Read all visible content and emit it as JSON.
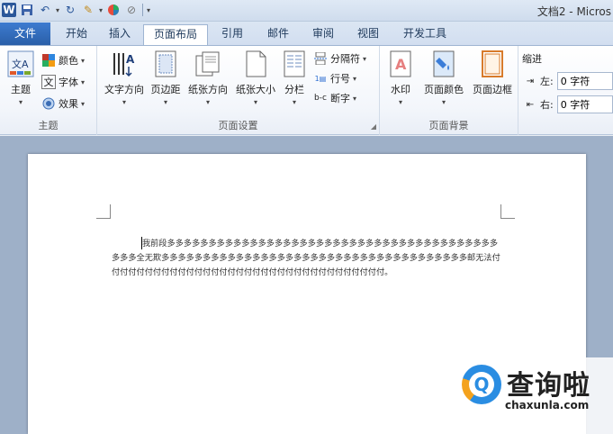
{
  "titlebar": {
    "title": "文档2 - Micros"
  },
  "tabs": [
    {
      "label": "文件"
    },
    {
      "label": "开始"
    },
    {
      "label": "插入"
    },
    {
      "label": "页面布局"
    },
    {
      "label": "引用"
    },
    {
      "label": "邮件"
    },
    {
      "label": "审阅"
    },
    {
      "label": "视图"
    },
    {
      "label": "开发工具"
    }
  ],
  "ribbon": {
    "theme": {
      "label": "主题",
      "themes_btn": "主题",
      "colors_btn": "颜色",
      "fonts_btn": "字体",
      "effects_btn": "效果"
    },
    "page_setup": {
      "label": "页面设置",
      "text_direction": "文字方向",
      "margins": "页边距",
      "orientation": "纸张方向",
      "size": "纸张大小",
      "columns": "分栏",
      "breaks": "分隔符",
      "line_numbers": "行号",
      "hyphenation": "断字"
    },
    "page_background": {
      "label": "页面背景",
      "watermark": "水印",
      "page_color": "页面颜色",
      "page_borders": "页面边框"
    },
    "indent": {
      "title": "缩进",
      "left_label": "左:",
      "left_value": "0 字符",
      "right_label": "右:",
      "right_value": "0 字符"
    }
  },
  "document": {
    "text": "我前段多多多多多多多多多多多多多多多多多多多多多多多多多多多多多多多多多多多多多多多多多多多全无欺多多多多多多多多多多多多多多多多多多多多多多多多多多多多多多多多多多多多多邮无法付付付付付付付付付付付付付付付付付付付付付付付付付付付付付付付付付付。"
  },
  "watermark": {
    "brand": "查询啦",
    "url": "chaxunla.com",
    "logo_letter": "Q"
  }
}
